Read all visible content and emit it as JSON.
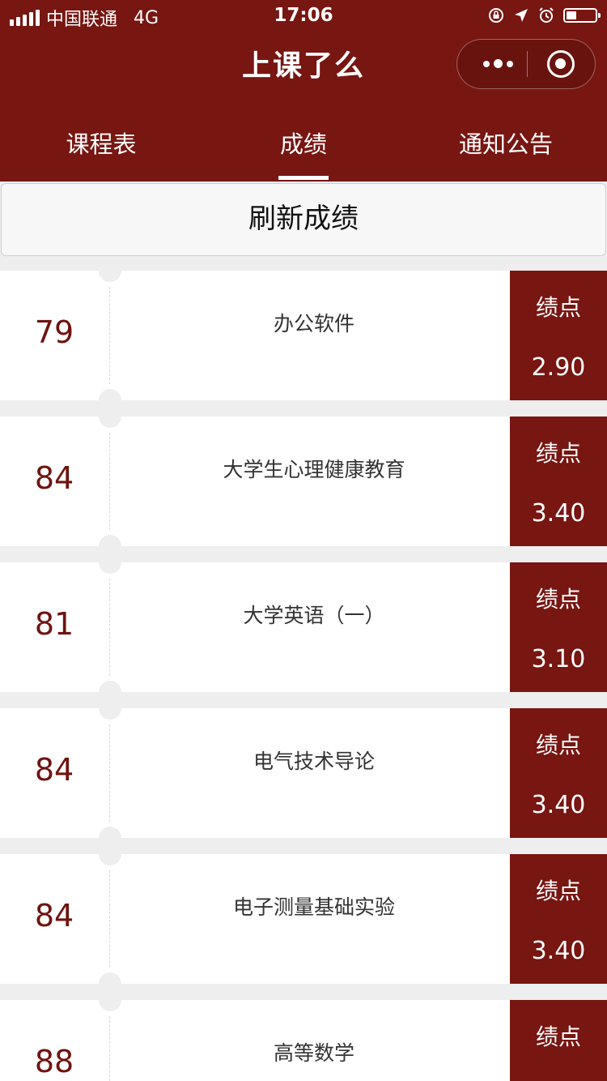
{
  "status_bar": {
    "carrier": "中国联通",
    "network": "4G",
    "time": "17:06"
  },
  "header": {
    "title": "上课了么"
  },
  "tabs": [
    {
      "label": "课程表",
      "active": false
    },
    {
      "label": "成绩",
      "active": true
    },
    {
      "label": "通知公告",
      "active": false
    }
  ],
  "refresh_button": {
    "label": "刷新成绩"
  },
  "grades": [
    {
      "score": "79",
      "course": "办公软件",
      "gp_label": "绩点",
      "gp": "2.90"
    },
    {
      "score": "84",
      "course": "大学生心理健康教育",
      "gp_label": "绩点",
      "gp": "3.40"
    },
    {
      "score": "81",
      "course": "大学英语（一）",
      "gp_label": "绩点",
      "gp": "3.10"
    },
    {
      "score": "84",
      "course": "电气技术导论",
      "gp_label": "绩点",
      "gp": "3.40"
    },
    {
      "score": "84",
      "course": "电子测量基础实验",
      "gp_label": "绩点",
      "gp": "3.40"
    },
    {
      "score": "88",
      "course": "高等数学",
      "gp_label": "绩点",
      "gp": ""
    }
  ],
  "colors": {
    "brand": "#781612",
    "score_text": "#6e1410",
    "background": "#eeeeee"
  }
}
